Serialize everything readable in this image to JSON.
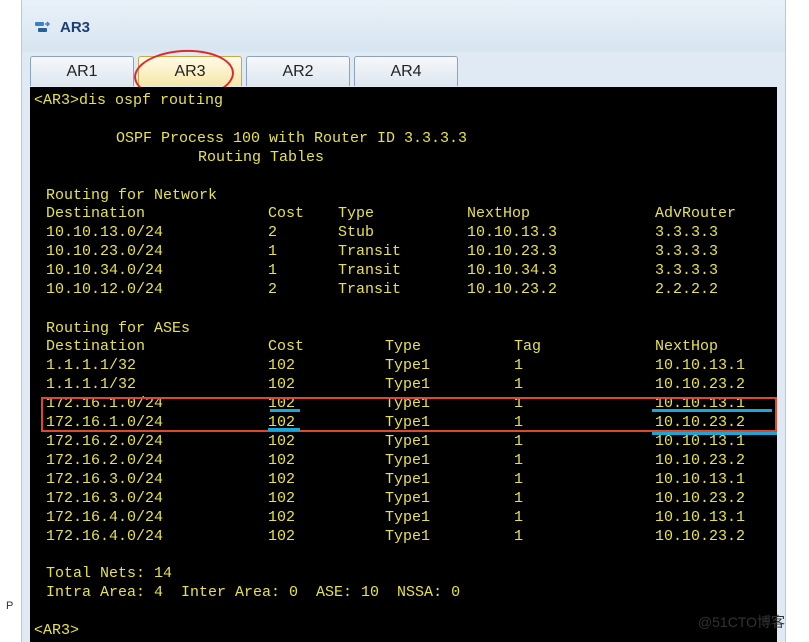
{
  "window": {
    "title": "AR3"
  },
  "tabs": [
    "AR1",
    "AR3",
    "AR2",
    "AR4"
  ],
  "active_tab": "AR3",
  "terminal": {
    "prompt_cmd": "<AR3>dis ospf routing",
    "header1": "OSPF Process 100 with Router ID 3.3.3.3",
    "header2": "Routing Tables",
    "network_title": "Routing for Network",
    "network_cols": [
      "Destination",
      "Cost",
      "Type",
      "NextHop",
      "AdvRouter"
    ],
    "network_rows": [
      [
        "10.10.13.0/24",
        "2",
        "Stub",
        "10.10.13.3",
        "3.3.3.3"
      ],
      [
        "10.10.23.0/24",
        "1",
        "Transit",
        "10.10.23.3",
        "3.3.3.3"
      ],
      [
        "10.10.34.0/24",
        "1",
        "Transit",
        "10.10.34.3",
        "3.3.3.3"
      ],
      [
        "10.10.12.0/24",
        "2",
        "Transit",
        "10.10.23.2",
        "2.2.2.2"
      ]
    ],
    "ase_title": "Routing for ASEs",
    "ase_cols": [
      "Destination",
      "Cost",
      "Type",
      "Tag",
      "NextHop"
    ],
    "ase_rows": [
      [
        "1.1.1.1/32",
        "102",
        "Type1",
        "1",
        "10.10.13.1"
      ],
      [
        "1.1.1.1/32",
        "102",
        "Type1",
        "1",
        "10.10.23.2"
      ],
      [
        "172.16.1.0/24",
        "102",
        "Type1",
        "1",
        "10.10.13.1"
      ],
      [
        "172.16.1.0/24",
        "102",
        "Type1",
        "1",
        "10.10.23.2"
      ],
      [
        "172.16.2.0/24",
        "102",
        "Type1",
        "1",
        "10.10.13.1"
      ],
      [
        "172.16.2.0/24",
        "102",
        "Type1",
        "1",
        "10.10.23.2"
      ],
      [
        "172.16.3.0/24",
        "102",
        "Type1",
        "1",
        "10.10.13.1"
      ],
      [
        "172.16.3.0/24",
        "102",
        "Type1",
        "1",
        "10.10.23.2"
      ],
      [
        "172.16.4.0/24",
        "102",
        "Type1",
        "1",
        "10.10.13.1"
      ],
      [
        "172.16.4.0/24",
        "102",
        "Type1",
        "1",
        "10.10.23.2"
      ]
    ],
    "total_nets": "Total Nets: 14",
    "summary": "Intra Area: 4  Inter Area: 0  ASE: 10  NSSA: 0",
    "prompt_end": "<AR3>"
  },
  "watermark": "@51CTO博客",
  "left_mark": "P",
  "colors": {
    "terminal_text": "#e8e24a",
    "annotation_red": "#e0282a",
    "annotation_blue": "#1aa7d6"
  },
  "icons": {
    "app": "router-app-icon"
  }
}
